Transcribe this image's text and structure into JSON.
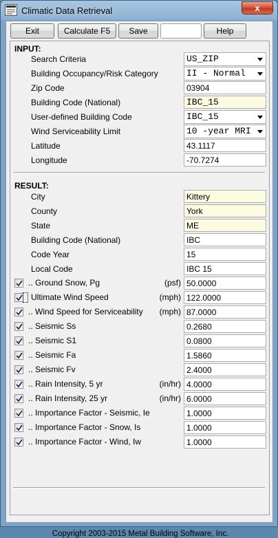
{
  "window": {
    "title": "Climatic Data Retrieval",
    "close_glyph": "x",
    "app_icon": "document-app-icon"
  },
  "toolbar": {
    "exit_label": "Exit",
    "calculate_label": "Calculate F5",
    "save_label": "Save",
    "blank_label": "",
    "help_label": "Help"
  },
  "input": {
    "title": "INPUT:",
    "search_criteria": {
      "label": "Search Criteria",
      "value": "US_ZIP"
    },
    "occupancy": {
      "label": "Building Occupancy/Risk Category",
      "value": "II - Normal"
    },
    "zip": {
      "label": "Zip Code",
      "value": "03904"
    },
    "building_code": {
      "label": "Building Code (National)",
      "value": "IBC_15"
    },
    "user_code": {
      "label": "User-defined Building Code",
      "value": "IBC_15"
    },
    "wind_service": {
      "label": "Wind Serviceability Limit",
      "value": "10 -year MRI"
    },
    "latitude": {
      "label": "Latitude",
      "value": "43.1117"
    },
    "longitude": {
      "label": "Longitude",
      "value": "-70.7274"
    }
  },
  "result": {
    "title": "RESULT:",
    "city": {
      "label": "City",
      "value": "Kittery"
    },
    "county": {
      "label": "County",
      "value": "York"
    },
    "state": {
      "label": "State",
      "value": "ME"
    },
    "building_code": {
      "label": "Building Code (National)",
      "value": "IBC"
    },
    "code_year": {
      "label": "Code Year",
      "value": "15"
    },
    "local_code": {
      "label": "Local Code",
      "value": "IBC 15"
    },
    "checked_rows": [
      {
        "label": ".. Ground Snow, Pg",
        "unit": "(psf)",
        "value": "50.0000",
        "checked": true
      },
      {
        "label": "Ultimate Wind Speed",
        "unit": "(mph)",
        "value": "122.0000",
        "checked": true
      },
      {
        "label": ".. Wind Speed for Serviceability",
        "unit": "(mph)",
        "value": "87.0000",
        "checked": true
      },
      {
        "label": ".. Seismic Ss",
        "unit": "",
        "value": "0.2680",
        "checked": true
      },
      {
        "label": ".. Seismic S1",
        "unit": "",
        "value": "0.0800",
        "checked": true
      },
      {
        "label": ".. Seismic Fa",
        "unit": "",
        "value": "1.5860",
        "checked": true
      },
      {
        "label": ".. Seismic Fv",
        "unit": "",
        "value": "2.4000",
        "checked": true
      },
      {
        "label": ".. Rain Intensity, 5 yr",
        "unit": "(in/hr)",
        "value": "4.0000",
        "checked": true
      },
      {
        "label": ".. Rain Intensity, 25 yr",
        "unit": "(in/hr)",
        "value": "6.0000",
        "checked": true
      },
      {
        "label": ".. Importance Factor - Seismic, Ie",
        "unit": "",
        "value": "1.0000",
        "checked": true
      },
      {
        "label": ".. Importance Factor - Snow, Is",
        "unit": "",
        "value": "1.0000",
        "checked": true
      },
      {
        "label": ".. Importance Factor - Wind, Iw",
        "unit": "",
        "value": "1.0000",
        "checked": true
      }
    ]
  },
  "footer": {
    "copyright": "Copyright 2003-2015  Metal Building Software, Inc."
  },
  "colors": {
    "readonly_bg": "#fcfae1",
    "close_red": "#c23a22",
    "title_blue": "#8fb2d3"
  }
}
